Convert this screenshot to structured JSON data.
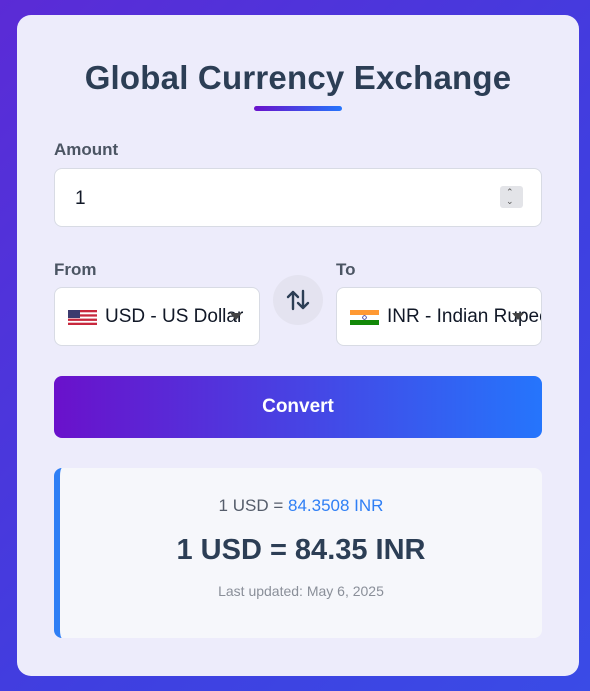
{
  "title": "Global Currency Exchange",
  "amount": {
    "label": "Amount",
    "value": "1"
  },
  "from": {
    "label": "From",
    "selected": "USD - US Dollar",
    "flag": "us-flag"
  },
  "to": {
    "label": "To",
    "selected": "INR - Indian Rupee",
    "flag": "india-flag"
  },
  "swap": {
    "icon": "swap-vertical-arrows-icon"
  },
  "convert_label": "Convert",
  "result": {
    "rate_prefix": "1 USD =",
    "rate_value": "84.3508 INR",
    "main": "1 USD = 84.35 INR",
    "updated": "Last updated: May 6, 2025"
  },
  "colors": {
    "accent_start": "#6a11cb",
    "accent_end": "#2575fc",
    "rate_blue": "#2f7ff5",
    "title": "#2c3e55"
  }
}
